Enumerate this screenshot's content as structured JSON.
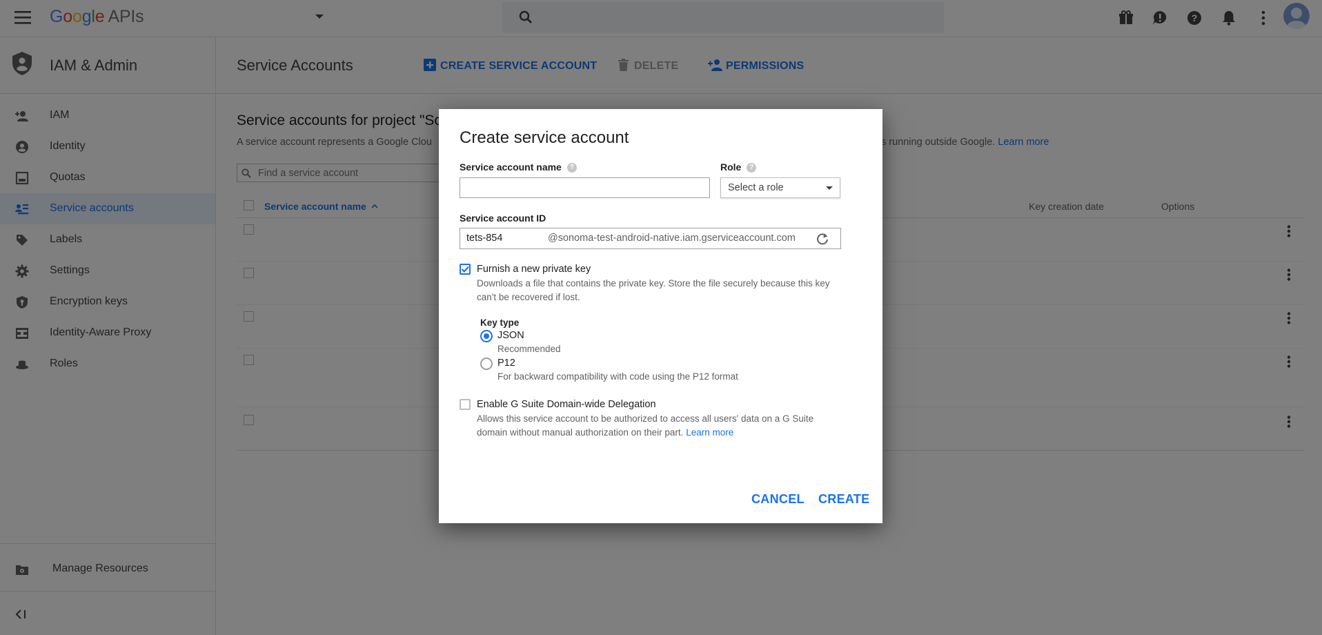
{
  "topbar": {
    "logo_google": "Google",
    "logo_apis": "APIs"
  },
  "sidebar": {
    "title": "IAM & Admin",
    "items": [
      {
        "label": "IAM",
        "icon": "person-add-icon"
      },
      {
        "label": "Identity",
        "icon": "account-circle-icon"
      },
      {
        "label": "Quotas",
        "icon": "quota-icon"
      },
      {
        "label": "Service accounts",
        "icon": "service-account-icon"
      },
      {
        "label": "Labels",
        "icon": "label-icon"
      },
      {
        "label": "Settings",
        "icon": "gear-icon"
      },
      {
        "label": "Encryption keys",
        "icon": "shield-key-icon"
      },
      {
        "label": "Identity-Aware Proxy",
        "icon": "proxy-icon"
      },
      {
        "label": "Roles",
        "icon": "hat-icon"
      }
    ],
    "manage_resources": "Manage Resources"
  },
  "main": {
    "page_title": "Service Accounts",
    "create_btn": "CREATE SERVICE ACCOUNT",
    "delete_btn": "DELETE",
    "permissions_btn": "PERMISSIONS",
    "section_title": "Service accounts for project \"So",
    "description_left": "A service account represents a Google Clou",
    "description_right": "s running outside Google.",
    "learn_more": "Learn more",
    "filter_placeholder": "Find a service account",
    "columns": {
      "name": "Service account name",
      "key_date": "Key creation date",
      "options": "Options"
    }
  },
  "dialog": {
    "title": "Create service account",
    "name_label": "Service account name",
    "name_value": "",
    "role_label": "Role",
    "role_value": "Select a role",
    "id_label": "Service account ID",
    "id_value": "tets-854",
    "id_suffix": "@sonoma-test-android-native.iam.gserviceaccount.com",
    "furnish_label": "Furnish a new private key",
    "furnish_checked": true,
    "furnish_desc": "Downloads a file that contains the private key. Store the file securely because this key can't be recovered if lost.",
    "key_type_label": "Key type",
    "json_label": "JSON",
    "json_desc": "Recommended",
    "p12_label": "P12",
    "p12_desc": "For backward compatibility with code using the P12 format",
    "gsuite_label": "Enable G Suite Domain-wide Delegation",
    "gsuite_checked": false,
    "gsuite_desc": "Allows this service account to be authorized to access all users' data on a G Suite domain without manual authorization on their part.",
    "gsuite_learn_more": "Learn more",
    "cancel": "CANCEL",
    "create": "CREATE"
  },
  "colors": {
    "accent": "#1a73e8",
    "overlay": "rgba(0,0,0,0.5)"
  }
}
